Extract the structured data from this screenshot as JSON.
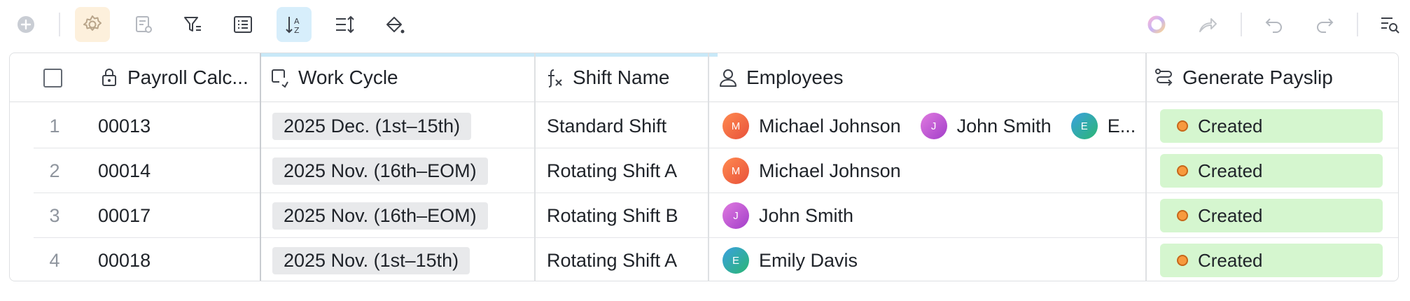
{
  "toolbar": {
    "left_icons": [
      "add-circle-icon",
      "settings-icon",
      "form-settings-icon",
      "filter-icon",
      "list-view-icon",
      "sort-az-icon",
      "row-height-icon",
      "fill-color-icon"
    ],
    "right_icons": [
      "ai-ring-icon",
      "share-icon",
      "undo-icon",
      "redo-icon",
      "search-table-icon"
    ]
  },
  "columns": {
    "payroll": "Payroll Calc...",
    "work_cycle": "Work Cycle",
    "shift_name": "Shift Name",
    "employees": "Employees",
    "generate_payslip": "Generate Payslip"
  },
  "rows": [
    {
      "num": "1",
      "payroll": "00013",
      "work_cycle": "2025 Dec. (1st–15th)",
      "shift_name": "Standard Shift",
      "employees": [
        {
          "initial": "M",
          "name": "Michael Johnson"
        },
        {
          "initial": "J",
          "name": "John Smith"
        },
        {
          "initial": "E",
          "name": "E..."
        }
      ],
      "status": "Created"
    },
    {
      "num": "2",
      "payroll": "00014",
      "work_cycle": "2025 Nov. (16th–EOM)",
      "shift_name": "Rotating Shift A",
      "employees": [
        {
          "initial": "M",
          "name": "Michael Johnson"
        }
      ],
      "status": "Created"
    },
    {
      "num": "3",
      "payroll": "00017",
      "work_cycle": "2025 Nov. (16th–EOM)",
      "shift_name": "Rotating Shift B",
      "employees": [
        {
          "initial": "J",
          "name": "John Smith"
        }
      ],
      "status": "Created"
    },
    {
      "num": "4",
      "payroll": "00018",
      "work_cycle": "2025 Nov. (1st–15th)",
      "shift_name": "Rotating Shift A",
      "employees": [
        {
          "initial": "E",
          "name": "Emily Davis"
        }
      ],
      "status": "Created"
    }
  ],
  "colors": {
    "status_bg": "#d5f6cf",
    "status_dot": "#f79a3e",
    "active_sort_bg": "#d7eefb",
    "active_settings_bg": "#fdf0dc"
  }
}
